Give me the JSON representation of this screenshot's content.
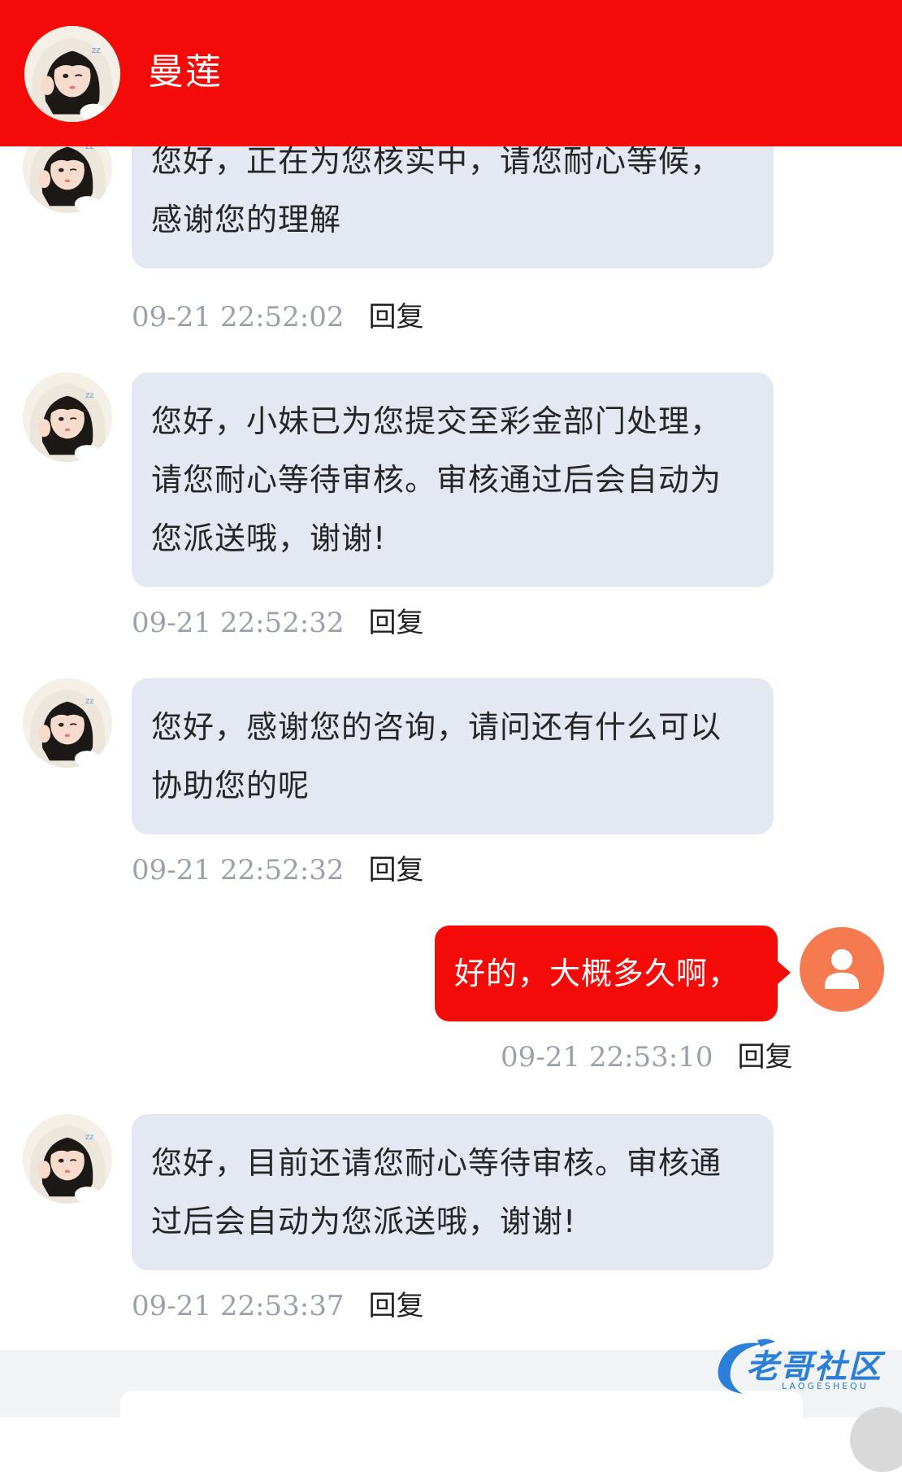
{
  "header": {
    "title": "曼莲",
    "bg_color": "#f40a06"
  },
  "messages": [
    {
      "sender": "agent",
      "text": "您好，正在为您核实中，请您耐心等候，感谢您的理解",
      "timestamp": "09-21 22:52:02",
      "reply_label": "回复"
    },
    {
      "sender": "agent",
      "text": "您好，小妹已为您提交至彩金部门处理，请您耐心等待审核。审核通过后会自动为您派送哦，谢谢!",
      "timestamp": "09-21 22:52:32",
      "reply_label": "回复"
    },
    {
      "sender": "agent",
      "text": "您好，感谢您的咨询，请问还有什么可以协助您的呢",
      "timestamp": "09-21 22:52:32",
      "reply_label": "回复"
    },
    {
      "sender": "user",
      "text": "好的，大概多久啊，",
      "timestamp": "09-21 22:53:10",
      "reply_label": "回复"
    },
    {
      "sender": "agent",
      "text": "您好，目前还请您耐心等待审核。审核通过后会自动为您派送哦，谢谢!",
      "timestamp": "09-21 22:53:37",
      "reply_label": "回复"
    }
  ],
  "watermark": {
    "text": "老哥社区",
    "subtext": "LAOGESHEQU"
  },
  "colors": {
    "agent_bubble": "#e3e8f2",
    "user_bubble": "#f40a06",
    "user_avatar": "#f57a4f",
    "timestamp": "#9aa1ad"
  },
  "icons": {
    "header_avatar": "agent-avatar-photo",
    "user_avatar": "user-person-icon"
  }
}
